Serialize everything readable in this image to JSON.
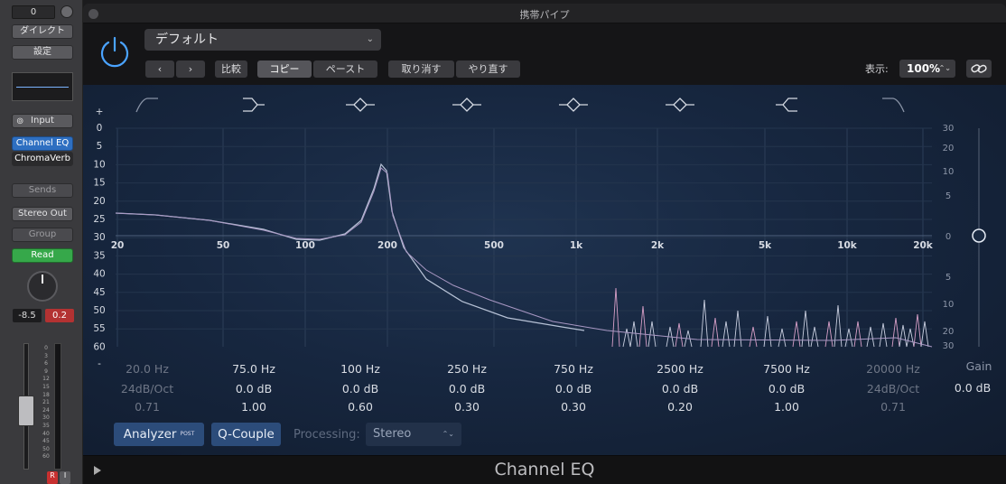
{
  "strip": {
    "top_value": "0",
    "direct_label": "ダイレクト",
    "settings_label": "設定",
    "input_label": "Input",
    "plugins": [
      "Channel EQ",
      "ChromaVerb"
    ],
    "sends_label": "Sends",
    "output_label": "Stereo Out",
    "group_label": "Group",
    "automation_label": "Read",
    "volume_value": "-8.5",
    "peak_value": "0.2",
    "fader_scale": [
      "0",
      "3",
      "6",
      "9",
      "12",
      "15",
      "18",
      "21",
      "24",
      "30",
      "35",
      "40",
      "45",
      "50",
      "60"
    ],
    "record_label": "R",
    "input_monitor_label": "I"
  },
  "window": {
    "title": "携帯パイプ",
    "plugin_name": "Channel EQ"
  },
  "header": {
    "preset": "デフォルト",
    "compare_label": "比較",
    "copy_label": "コピー",
    "paste_label": "ペースト",
    "undo_label": "取り消す",
    "redo_label": "やり直す",
    "zoom_label": "表示:",
    "zoom_value": "100%"
  },
  "eq": {
    "freq_ticks": [
      "20",
      "50",
      "100",
      "200",
      "500",
      "1k",
      "2k",
      "5k",
      "10k",
      "20k"
    ],
    "analyzer_scale_top": "+",
    "analyzer_scale": [
      "0",
      "5",
      "10",
      "15",
      "20",
      "25",
      "30",
      "35",
      "40",
      "45",
      "50",
      "55",
      "60"
    ],
    "analyzer_scale_bottom": "-",
    "gain_scale_top": [
      "30",
      "20",
      "10",
      "5",
      "0"
    ],
    "gain_scale_bottom": [
      "5",
      "10",
      "20",
      "30"
    ],
    "bands": [
      {
        "freq": "20.0 Hz",
        "gain": "24dB/Oct",
        "q": "0.71",
        "enabled": false,
        "shape": "lowcut"
      },
      {
        "freq": "75.0 Hz",
        "gain": "0.0 dB",
        "q": "1.00",
        "enabled": true,
        "shape": "lowshelf"
      },
      {
        "freq": "100 Hz",
        "gain": "0.0 dB",
        "q": "0.60",
        "enabled": true,
        "shape": "bell"
      },
      {
        "freq": "250 Hz",
        "gain": "0.0 dB",
        "q": "0.30",
        "enabled": true,
        "shape": "bell"
      },
      {
        "freq": "750 Hz",
        "gain": "0.0 dB",
        "q": "0.30",
        "enabled": true,
        "shape": "bell"
      },
      {
        "freq": "2500 Hz",
        "gain": "0.0 dB",
        "q": "0.20",
        "enabled": true,
        "shape": "bell"
      },
      {
        "freq": "7500 Hz",
        "gain": "0.0 dB",
        "q": "1.00",
        "enabled": true,
        "shape": "highshelf"
      },
      {
        "freq": "20000 Hz",
        "gain": "24dB/Oct",
        "q": "0.71",
        "enabled": false,
        "shape": "highcut"
      }
    ],
    "master_gain_label": "Gain",
    "master_gain_value": "0.0 dB"
  },
  "bottom": {
    "analyzer_label": "Analyzer",
    "analyzer_post": "POST",
    "qcouple_label": "Q-Couple",
    "processing_label": "Processing:",
    "processing_value": "Stereo"
  }
}
